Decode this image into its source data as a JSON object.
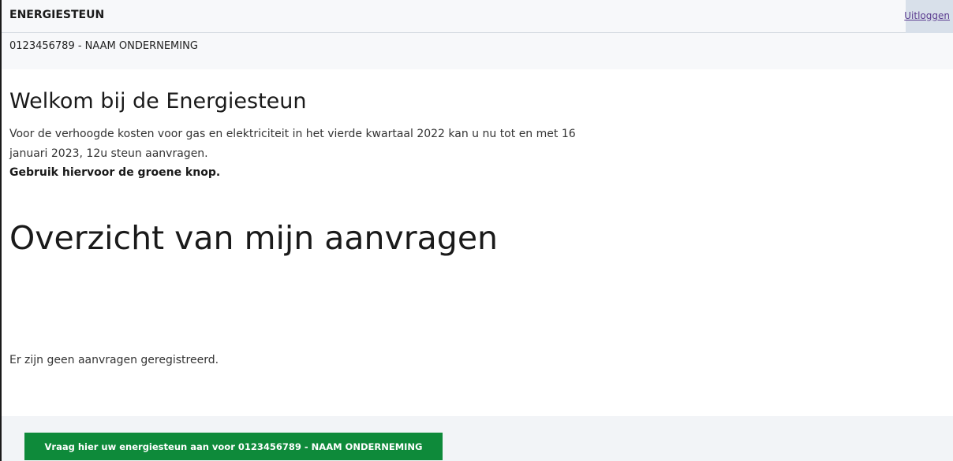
{
  "header": {
    "app_title": "ENERGIESTEUN",
    "logout_label": "Uitloggen"
  },
  "company": {
    "label": "0123456789 - NAAM ONDERNEMING"
  },
  "welcome": {
    "title": "Welkom bij de Energiesteun",
    "line1": "Voor de verhoogde kosten voor gas en elektriciteit in het vierde kwartaal 2022 kan u nu tot en met 16",
    "line2": "januari 2023, 12u steun aanvragen.",
    "bold_hint": "Gebruik hiervoor de groene knop."
  },
  "overview": {
    "title": "Overzicht van mijn aanvragen",
    "empty_message": "Er zijn geen aanvragen geregistreerd."
  },
  "action": {
    "button_label": "Vraag hier uw energiesteun aan voor 0123456789 - NAAM ONDERNEMING"
  },
  "colors": {
    "button_green": "#0e8a3a",
    "link_purple": "#5a3b8f",
    "bar_background": "#f7f8fa"
  }
}
